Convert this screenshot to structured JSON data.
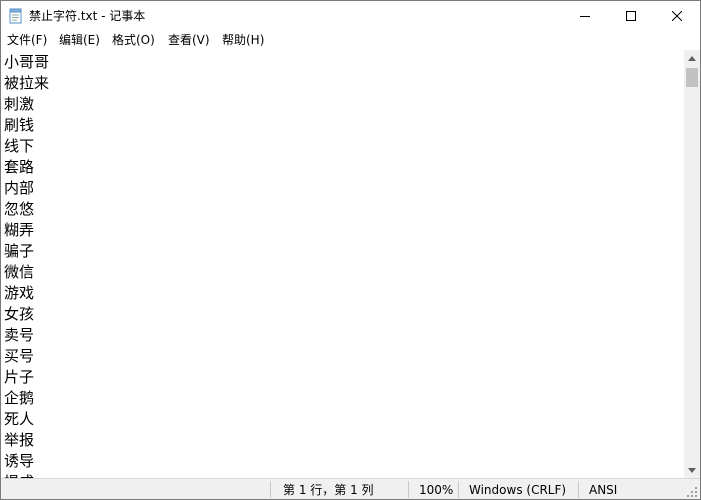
{
  "window": {
    "title": "禁止字符.txt - 记事本",
    "icon": "notepad-icon",
    "buttons": {
      "minimize": "minimize-icon",
      "maximize": "maximize-icon",
      "close": "close-icon"
    }
  },
  "menu": {
    "file": "文件(F)",
    "edit": "编辑(E)",
    "format": "格式(O)",
    "view": "查看(V)",
    "help": "帮助(H)"
  },
  "content": {
    "lines": [
      "小哥哥",
      "被拉来",
      "刺激",
      "刷钱",
      "线下",
      "套路",
      "内部",
      "忽悠",
      "糊弄",
      "骗子",
      "微信",
      "游戏",
      "女孩",
      "卖号",
      "买号",
      "片子",
      "企鹅",
      "死人",
      "举报",
      "诱导",
      "提成"
    ]
  },
  "status": {
    "position": "第 1 行，第 1 列",
    "zoom": "100%",
    "line_ending": "Windows (CRLF)",
    "encoding": "ANSI"
  },
  "scrollbar": {
    "position_fraction": 0.0
  }
}
